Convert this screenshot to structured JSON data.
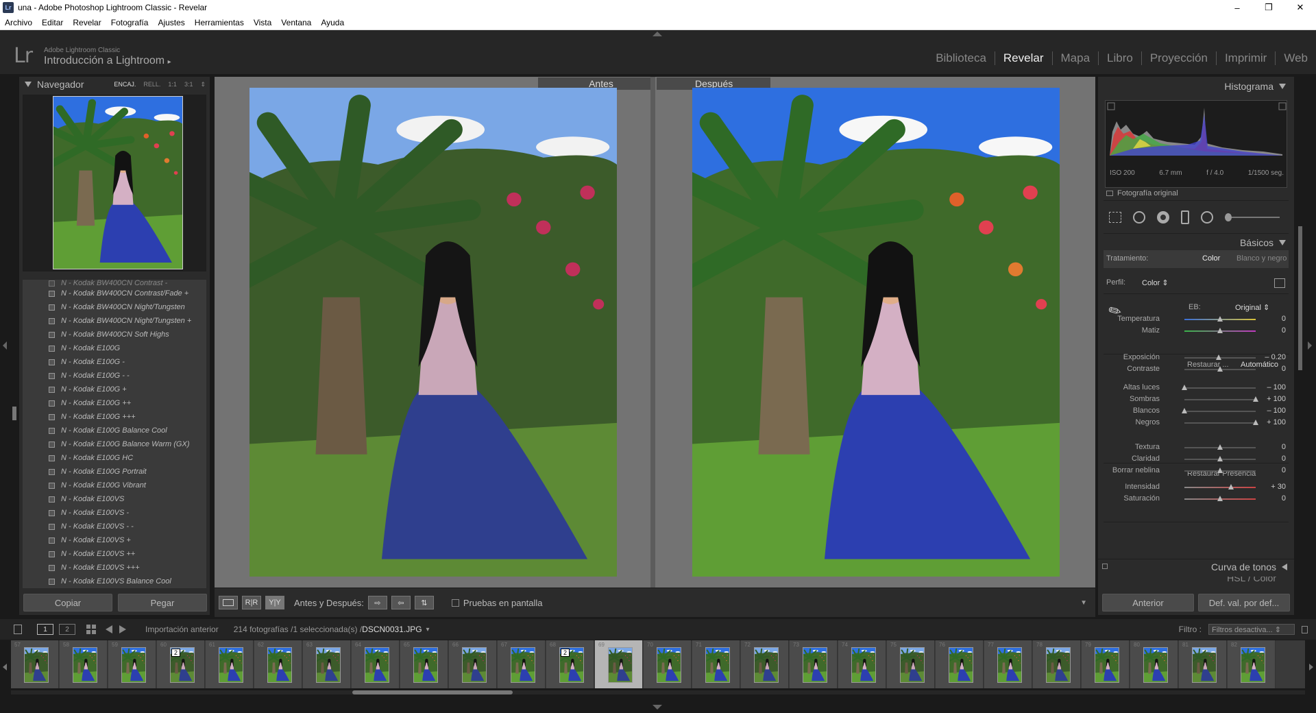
{
  "window": {
    "title": "una - Adobe Photoshop Lightroom Classic - Revelar",
    "app_badge": "Lr",
    "minimize": "–",
    "maximize": "❐",
    "close": "✕"
  },
  "menu": [
    "Archivo",
    "Editar",
    "Revelar",
    "Fotografía",
    "Ajustes",
    "Herramientas",
    "Vista",
    "Ventana",
    "Ayuda"
  ],
  "identity": {
    "logo": "Lr",
    "app": "Adobe Lightroom Classic",
    "catalog": "Introducción a Lightroom",
    "catalog_arrow": "▸"
  },
  "modules": [
    "Biblioteca",
    "Revelar",
    "Mapa",
    "Libro",
    "Proyección",
    "Imprimir",
    "Web"
  ],
  "active_module": "Revelar",
  "navigator": {
    "title": "Navegador",
    "zoom": [
      "ENCAJ.",
      "RELL.",
      "1:1",
      "3:1"
    ],
    "zoom_active": "ENCAJ.",
    "zoom_menu": "⇕"
  },
  "presets": {
    "truncated_top": "N - Kodak BW400CN Contrast -",
    "items": [
      "N - Kodak BW400CN Contrast/Fade +",
      "N - Kodak BW400CN Night/Tungsten",
      "N - Kodak BW400CN Night/Tungsten +",
      "N - Kodak BW400CN Soft Highs",
      "N - Kodak E100G",
      "N - Kodak E100G -",
      "N - Kodak E100G - -",
      "N - Kodak E100G +",
      "N - Kodak E100G ++",
      "N - Kodak E100G +++",
      "N - Kodak E100G Balance Cool",
      "N - Kodak E100G Balance Warm (GX)",
      "N - Kodak E100G HC",
      "N - Kodak E100G Portrait",
      "N - Kodak E100G Vibrant",
      "N - Kodak E100VS",
      "N - Kodak E100VS -",
      "N - Kodak E100VS - -",
      "N - Kodak E100VS +",
      "N - Kodak E100VS ++",
      "N - Kodak E100VS +++",
      "N - Kodak E100VS Balance Cool"
    ]
  },
  "left_buttons": {
    "copy": "Copiar",
    "paste": "Pegar"
  },
  "compare": {
    "before": "Antes",
    "after": "Después"
  },
  "toolbar": {
    "view_rr": "R|R",
    "view_yy": "Y|Y",
    "label": "Antes y Después:",
    "swap1": "⇨",
    "swap2": "⇦",
    "swap3": "⇅",
    "softproof": "Pruebas en pantalla",
    "dropdown": "▼"
  },
  "histogram": {
    "title": "Histograma",
    "iso": "ISO 200",
    "focal": "6.7 mm",
    "aperture": "f / 4.0",
    "shutter": "1/1500 seg.",
    "original": "Fotografía original"
  },
  "basic": {
    "title": "Básicos",
    "treatment_label": "Tratamiento:",
    "treatment_color": "Color",
    "treatment_bw": "Blanco y negro",
    "profile_label": "Perfil:",
    "profile_value": "Color ⇕",
    "wb_label": "EB:",
    "wb_value": "Original ⇕",
    "tone_label": "Restaurar ...",
    "tone_auto": "Automático",
    "presence_label": "Restaurar Presencia",
    "sliders": [
      {
        "name": "Temperatura",
        "value": "0",
        "pos": 0.5
      },
      {
        "name": "Matiz",
        "value": "0",
        "pos": 0.5
      },
      {
        "name": "Exposición",
        "value": "– 0.20",
        "pos": 0.48
      },
      {
        "name": "Contraste",
        "value": "0",
        "pos": 0.5
      },
      {
        "name": "Altas luces",
        "value": "– 100",
        "pos": 0.0
      },
      {
        "name": "Sombras",
        "value": "+ 100",
        "pos": 1.0
      },
      {
        "name": "Blancos",
        "value": "– 100",
        "pos": 0.0
      },
      {
        "name": "Negros",
        "value": "+ 100",
        "pos": 1.0
      },
      {
        "name": "Textura",
        "value": "0",
        "pos": 0.5
      },
      {
        "name": "Claridad",
        "value": "0",
        "pos": 0.5
      },
      {
        "name": "Borrar neblina",
        "value": "0",
        "pos": 0.5
      },
      {
        "name": "Intensidad",
        "value": "+ 30",
        "pos": 0.65
      },
      {
        "name": "Saturación",
        "value": "0",
        "pos": 0.5
      }
    ],
    "tone_curve": "Curva de tonos",
    "hsl_partial": "HSL / Color"
  },
  "right_buttons": {
    "prev": "Anterior",
    "defaults": "Def. val. por def..."
  },
  "filmbar": {
    "page1": "1",
    "page2": "2",
    "source": "Importación anterior",
    "count": "214 fotografías /1 seleccionada(s) /",
    "file": "DSCN0031.JPG",
    "file_menu": "▾",
    "filter_label": "Filtro :",
    "filter_value": "Filtros desactiva... ⇕"
  },
  "film_numbers": [
    "57",
    "58",
    "59",
    "60",
    "61",
    "62",
    "63",
    "64",
    "65",
    "66",
    "67",
    "68",
    "69",
    "70",
    "71",
    "72",
    "73",
    "74",
    "75",
    "76",
    "77",
    "78",
    "79",
    "80",
    "81",
    "82"
  ],
  "film_badges": {
    "3": "2",
    "11": "2"
  },
  "film_selected": 12,
  "colors": {
    "accent": "#eeeeee",
    "panel": "#2b2b2b",
    "bg": "#1a1a1a",
    "sky_after": "#2e6fe0",
    "dress": "#2c3f95"
  }
}
